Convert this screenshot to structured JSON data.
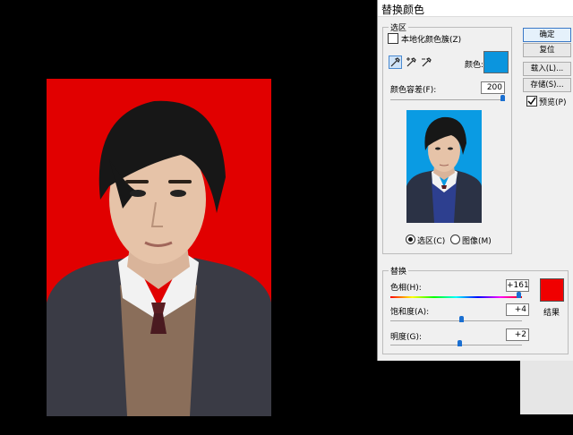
{
  "dialog": {
    "title": "替换颜色",
    "selection": {
      "legend": "选区",
      "localized_label": "本地化颜色簇(Z)",
      "color_label": "颜色:",
      "fuzziness_label": "颜色容差(F):",
      "fuzziness_value": "200",
      "fuzziness_fraction": 1.0,
      "selection_radio_label": "选区(C)",
      "image_radio_label": "图像(M)",
      "selected_radio": "selection",
      "sample_color": "#0b95de"
    },
    "buttons": {
      "ok": "确定",
      "reset": "复位",
      "load": "载入(L)...",
      "save": "存储(S)...",
      "preview_label": "预览(P)"
    },
    "replacement": {
      "legend": "替换",
      "hue_label": "色相(H):",
      "hue_value": "+161",
      "saturation_label": "饱和度(A):",
      "saturation_value": "+4",
      "lightness_label": "明度(G):",
      "lightness_value": "+2",
      "result_label": "结果",
      "result_color": "#f00000"
    }
  },
  "canvas": {
    "background_color": "#e10000",
    "preview_background": "#0a9be3"
  }
}
